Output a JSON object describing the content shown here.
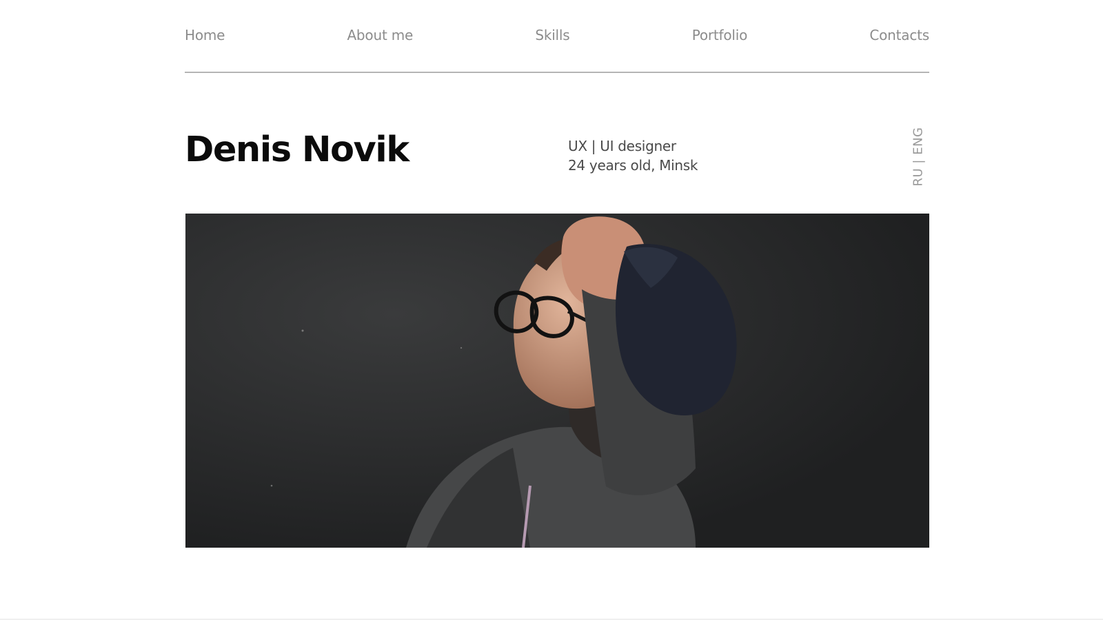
{
  "nav": {
    "items": [
      {
        "label": "Home"
      },
      {
        "label": "About me"
      },
      {
        "label": "Skills"
      },
      {
        "label": "Portfolio"
      },
      {
        "label": "Contacts"
      }
    ]
  },
  "hero": {
    "name": "Denis Novik",
    "role": "UX | UI designer",
    "details": "24 years old, Minsk",
    "language_switch": "RU | ENG"
  },
  "colors": {
    "background": "#ffffff",
    "nav_text": "#8c8c8c",
    "divider": "#b5b5b5",
    "title": "#0b0b0b",
    "photo_background": "#242526"
  },
  "icons": {
    "photo": "portrait-photo"
  }
}
